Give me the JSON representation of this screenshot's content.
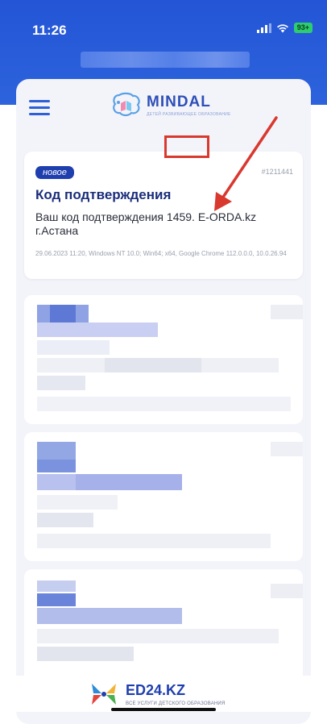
{
  "status_bar": {
    "time": "11:26",
    "battery": "93+"
  },
  "header": {
    "logo_text": "MINDAL",
    "logo_subtitle": "ДЕТЕЙ РАЗВИВАЮЩЕЕ ОБРАЗОВАНИЕ"
  },
  "notification": {
    "badge": "новое",
    "id": "#1211441",
    "title": "Код подтверждения",
    "body_prefix": "Ваш код подтверждения ",
    "code": "1459.",
    "body_suffix": " E-ORDA.kz",
    "body_line2": "г.Астана",
    "meta": "29.06.2023 11:20, Windows NT 10.0; Win64; x64, Google Chrome 112.0.0.0, 10.0.26.94"
  },
  "footer": {
    "title": "ED24.KZ",
    "subtitle": "ВСЕ УСЛУГИ ДЕТСКОГО ОБРАЗОВАНИЯ"
  },
  "colors": {
    "primary": "#2d5fd6",
    "highlight": "#d9382f",
    "title": "#1a2d7a"
  }
}
